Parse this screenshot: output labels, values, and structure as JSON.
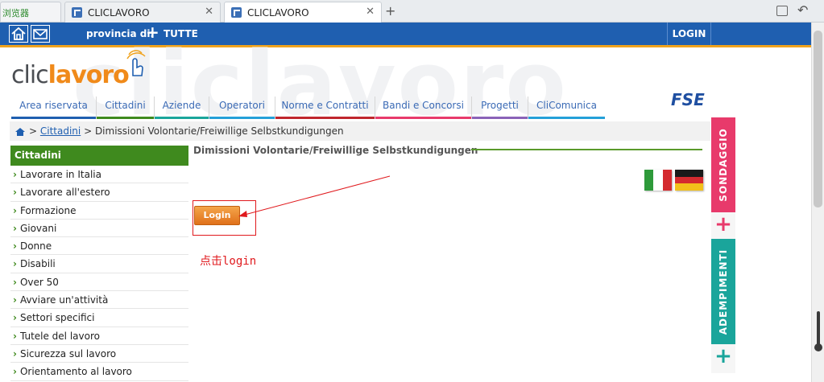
{
  "browser": {
    "first_tab_label": "浏览器",
    "tabs": [
      {
        "title": "CLICLAVORO"
      },
      {
        "title": "CLICLAVORO"
      }
    ]
  },
  "topbar": {
    "provincia_label": "provincia di:",
    "provincia_value": "TUTTE",
    "login_label": "LOGIN"
  },
  "logo": {
    "part1": "clic",
    "part2": "lavoro"
  },
  "watermark": "cliclavoro",
  "fse": "FSE",
  "nav": {
    "items": [
      {
        "label": "Area riservata",
        "color": "#1f5fb0"
      },
      {
        "label": "Cittadini",
        "color": "#3f8a1e"
      },
      {
        "label": "Aziende",
        "color": "#1aa59b"
      },
      {
        "label": "Operatori",
        "color": "#24a0d8"
      },
      {
        "label": "Norme e Contratti",
        "color": "#c0262d"
      },
      {
        "label": "Bandi e Concorsi",
        "color": "#e83a6b"
      },
      {
        "label": "Progetti",
        "color": "#8a62b8"
      },
      {
        "label": "CliComunica",
        "color": "#24a0d8"
      }
    ]
  },
  "breadcrumb": {
    "link": "Cittadini",
    "current": "Dimissioni Volontarie/Freiwillige Selbstkundigungen"
  },
  "sidebar": {
    "heading": "Cittadini",
    "items": [
      {
        "label": "Lavorare in Italia"
      },
      {
        "label": "Lavorare all'estero"
      },
      {
        "label": "Formazione"
      },
      {
        "label": "Giovani"
      },
      {
        "label": "Donne"
      },
      {
        "label": "Disabili"
      },
      {
        "label": "Over 50"
      },
      {
        "label": "Avviare un'attività"
      },
      {
        "label": "Settori specifici"
      },
      {
        "label": "Tutele del lavoro"
      },
      {
        "label": "Sicurezza sul lavoro"
      },
      {
        "label": "Orientamento al lavoro"
      }
    ]
  },
  "main": {
    "title": "Dimissioni Volontarie/Freiwillige Selbstkundigungen",
    "login_button": "Login",
    "annotation": "点击login"
  },
  "right_tabs": {
    "sondaggio": "SONDAGGIO",
    "adempimenti": "ADEMPIMENTI"
  },
  "colors": {
    "topbar_blue": "#1f5fb0",
    "accent_orange": "#f08a1a",
    "sidebar_green": "#3f8a1e",
    "sondaggio_pink": "#e83a6b",
    "adempimenti_teal": "#1aa59b",
    "annotation_red": "#e0191d"
  }
}
